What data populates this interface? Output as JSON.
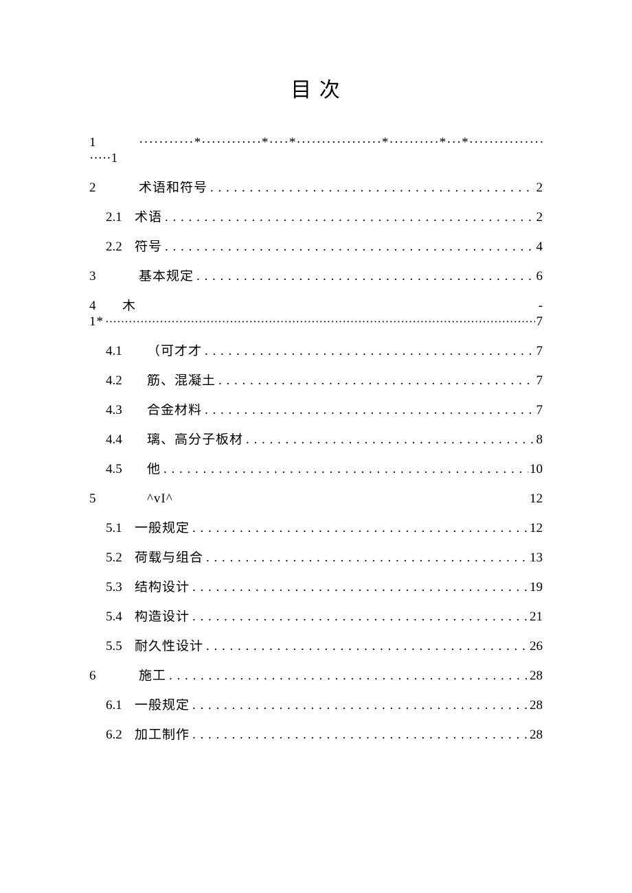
{
  "title": "目 次",
  "entries": {
    "e1_num": "1",
    "e1_fill": "···········*············*····*·················*··········*···*·······················*····",
    "e1_wrap": "·····1",
    "e2_num": "2",
    "e2_label": "术语和符号",
    "e2_page": "2",
    "e21_num": "2.1",
    "e21_label": "术语",
    "e21_page": "2",
    "e22_num": "2.2",
    "e22_label": "符号",
    "e22_page": "4",
    "e3_num": "3",
    "e3_label": "基本规定",
    "e3_page": "6",
    "e4_num": "4",
    "e4_label": "木",
    "e4_trail": "-",
    "e4_wrap_a": "1*",
    "e4_wrap_b": "7",
    "e41_num": "4.1",
    "e41_label": "（可才才",
    "e41_page": "7",
    "e42_num": "4.2",
    "e42_label": "筋、混凝土",
    "e42_page": "7",
    "e43_num": "4.3",
    "e43_label": "合金材料",
    "e43_page": "7",
    "e44_num": "4.4",
    "e44_label": "璃、高分子板材",
    "e44_page": "8",
    "e45_num": "4.5",
    "e45_label": "他",
    "e45_page": "10",
    "e5_num": "5",
    "e5_label": "^vI^",
    "e5_page": "12",
    "e51_num": "5.1",
    "e51_label": "一般规定",
    "e51_page": "12",
    "e52_num": "5.2",
    "e52_label": "荷载与组合",
    "e52_page": "13",
    "e53_num": "5.3",
    "e53_label": "结构设计",
    "e53_page": "19",
    "e54_num": "5.4",
    "e54_label": "构造设计",
    "e54_page": "21",
    "e55_num": "5.5",
    "e55_label": "耐久性设计",
    "e55_page": "26",
    "e6_num": "6",
    "e6_label": "施工",
    "e6_page": "28",
    "e61_num": "6.1",
    "e61_label": "一般规定",
    "e61_page": "28",
    "e62_num": "6.2",
    "e62_label": "加工制作",
    "e62_page": "28"
  }
}
